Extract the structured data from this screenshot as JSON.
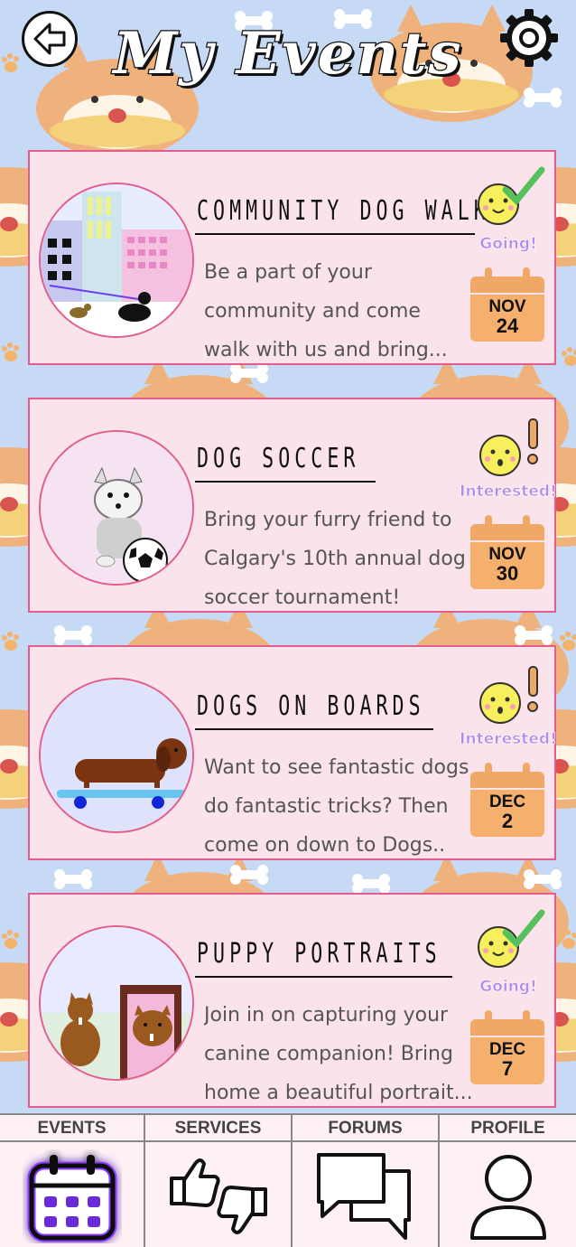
{
  "header": {
    "title": "My Events"
  },
  "events": [
    {
      "title": "COMMUNITY DOG WALK",
      "desc": [
        "Be a part of your",
        "community and come",
        "walk with us and bring..."
      ],
      "status": "Going!",
      "status_type": "going",
      "month": "NOV",
      "day": "24"
    },
    {
      "title": "DOG SOCCER",
      "desc": [
        "Bring your furry friend to",
        "Calgary's 10th annual dog",
        "soccer tournament!"
      ],
      "status": "Interested!",
      "status_type": "interested",
      "month": "NOV",
      "day": "30"
    },
    {
      "title": "DOGS ON BOARDS",
      "desc": [
        "Want to see fantastic dogs",
        "do fantastic tricks? Then",
        "come on down to Dogs.."
      ],
      "status": "Interested!",
      "status_type": "interested",
      "month": "DEC",
      "day": "2"
    },
    {
      "title": "PUPPY PORTRAITS",
      "desc": [
        " Join in on capturing your",
        "canine companion! Bring",
        "home a beautiful portrait..."
      ],
      "status": "Going!",
      "status_type": "going",
      "month": "DEC",
      "day": "7"
    }
  ],
  "nav": [
    {
      "label": "EVENTS",
      "icon": "calendar-icon",
      "active": true
    },
    {
      "label": "SERVICES",
      "icon": "thumbs-up-down-icon",
      "active": false
    },
    {
      "label": "FORUMS",
      "icon": "chat-bubbles-icon",
      "active": false
    },
    {
      "label": "PROFILE",
      "icon": "person-icon",
      "active": false
    }
  ],
  "colors": {
    "card_bg": "#fbe3ec",
    "card_border": "#e35d8c",
    "status_text": "#b48ae8",
    "calendar": "#f6b06d",
    "active_nav_glow": "#8a3dff",
    "background": "#c6daf6"
  }
}
